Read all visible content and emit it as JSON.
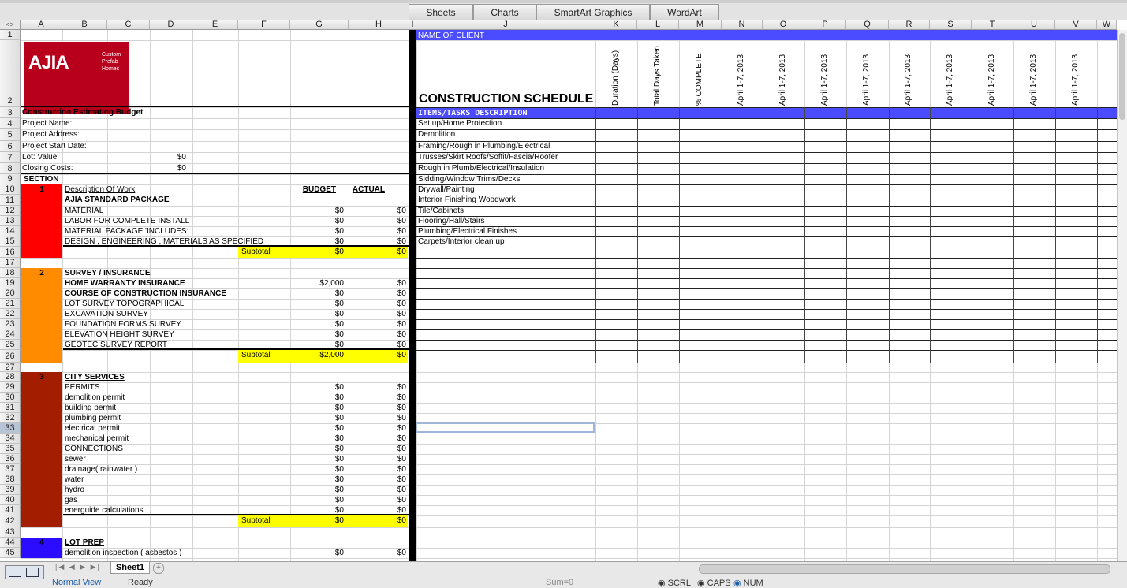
{
  "ribbon_tabs": [
    "Sheets",
    "Charts",
    "SmartArt Graphics",
    "WordArt"
  ],
  "columns": [
    "A",
    "B",
    "C",
    "D",
    "E",
    "F",
    "G",
    "H",
    "I",
    "J",
    "K",
    "L",
    "M",
    "N",
    "O",
    "P",
    "Q",
    "R",
    "S",
    "T",
    "U",
    "V",
    "W"
  ],
  "logo": {
    "brand": "AJIA",
    "tagline_1": "Custom",
    "tagline_2": "Prefab",
    "tagline_3": "Homes"
  },
  "colors": {
    "red": "#ff0000",
    "orange": "#ff8c00",
    "darkred": "#a31d00",
    "blue": "#2c0cff",
    "yellow": "#ffff00",
    "schedBlue": "#4b4bff"
  },
  "left": {
    "title": "Construction Estimating Budget",
    "project_name": "Project Name:",
    "project_address": "Project Address:",
    "project_start": "Project Start Date:",
    "lot_value": "Lot: Value",
    "lot_value_amt": "$0",
    "closing": "Closing Costs:",
    "closing_amt": "$0",
    "section": "SECTION",
    "desc_work": "Description Of Work",
    "budget_hdr": "BUDGET",
    "actual_hdr": "ACTUAL",
    "subtotal": "Subtotal",
    "sections": [
      {
        "num": "1",
        "title": "AJIA STANDARD PACKAGE",
        "items": [
          {
            "label": "MATERIAL",
            "budget": "$0",
            "actual": "$0"
          },
          {
            "label": "LABOR FOR COMPLETE INSTALL",
            "budget": "$0",
            "actual": "$0"
          },
          {
            "label": "MATERIAL PACKAGE 'INCLUDES:",
            "budget": "$0",
            "actual": "$0"
          },
          {
            "label": "DESIGN , ENGINEERING , MATERIALS AS SPECIFIED",
            "budget": "$0",
            "actual": "$0"
          }
        ],
        "sub_budget": "$0",
        "sub_actual": "$0"
      },
      {
        "num": "2",
        "title": "SURVEY / INSURANCE",
        "items": [
          {
            "label": "HOME WARRANTY INSURANCE",
            "budget": "$2,000",
            "actual": "$0"
          },
          {
            "label": "COURSE OF CONSTRUCTION INSURANCE",
            "budget": "$0",
            "actual": "$0"
          },
          {
            "label": "LOT SURVEY TOPOGRAPHICAL",
            "budget": "$0",
            "actual": "$0"
          },
          {
            "label": "EXCAVATION SURVEY",
            "budget": "$0",
            "actual": "$0"
          },
          {
            "label": "FOUNDATION FORMS SURVEY",
            "budget": "$0",
            "actual": "$0"
          },
          {
            "label": "ELEVATION HEIGHT SURVEY",
            "budget": "$0",
            "actual": "$0"
          },
          {
            "label": "GEOTEC SURVEY REPORT",
            "budget": "$0",
            "actual": "$0"
          }
        ],
        "sub_budget": "$2,000",
        "sub_actual": "$0"
      },
      {
        "num": "3",
        "title": "CITY SERVICES",
        "items": [
          {
            "label": "PERMITS",
            "budget": "$0",
            "actual": "$0"
          },
          {
            "label": "demolition permit",
            "budget": "$0",
            "actual": "$0"
          },
          {
            "label": "building permit",
            "budget": "$0",
            "actual": "$0"
          },
          {
            "label": "plumbing permit",
            "budget": "$0",
            "actual": "$0"
          },
          {
            "label": "electrical permit",
            "budget": "$0",
            "actual": "$0"
          },
          {
            "label": "mechanical permit",
            "budget": "$0",
            "actual": "$0"
          },
          {
            "label": "CONNECTIONS",
            "budget": "$0",
            "actual": "$0"
          },
          {
            "label": "sewer",
            "budget": "$0",
            "actual": "$0"
          },
          {
            "label": "drainage( rainwater )",
            "budget": "$0",
            "actual": "$0"
          },
          {
            "label": "water",
            "budget": "$0",
            "actual": "$0"
          },
          {
            "label": "hydro",
            "budget": "$0",
            "actual": "$0"
          },
          {
            "label": "gas",
            "budget": "$0",
            "actual": "$0"
          },
          {
            "label": "energuide calculations",
            "budget": "$0",
            "actual": "$0"
          }
        ],
        "sub_budget": "$0",
        "sub_actual": "$0"
      },
      {
        "num": "4",
        "title": "LOT PREP",
        "items": [
          {
            "label": "demolition inspection ( asbestos )",
            "budget": "$0",
            "actual": "$0"
          }
        ]
      }
    ]
  },
  "right": {
    "client": "NAME OF CLIENT",
    "sched_title": "CONSTRUCTION SCHEDULE",
    "items_hdr": "ITEMS/TASKS DESCRIPTION",
    "col_headers": [
      "Duration (Days)",
      "Total Days Taken",
      "% COMPLETE",
      "April 1-7, 2013",
      "April 1-7, 2013",
      "April 1-7, 2013",
      "April 1-7, 2013",
      "April 1-7, 2013",
      "April 1-7, 2013",
      "April 1-7, 2013",
      "April 1-7, 2013",
      "April 1-7, 2013"
    ],
    "tasks": [
      "Set up/Home Protection",
      "Demolition",
      "Framing/Rough in Plumbing/Electrical",
      "Trusses/Skirt Roofs/Soffit/Fascia/Roofer",
      "Rough in Plumb/Electrical/Insulation",
      "Sidding/Window Trims/Decks",
      "Drywall/Painting",
      "Interior Finishing Woodwork",
      "Tile/Cabinets",
      "Flooring/Hall/Stairs",
      "Plumbing/Electrical Finishes",
      "Carpets/Interior clean up"
    ]
  },
  "status": {
    "sheet_tab": "Sheet1",
    "view": "Normal View",
    "ready": "Ready",
    "sum": "Sum=0",
    "scrl": "SCRL",
    "caps": "CAPS",
    "num": "NUM"
  }
}
